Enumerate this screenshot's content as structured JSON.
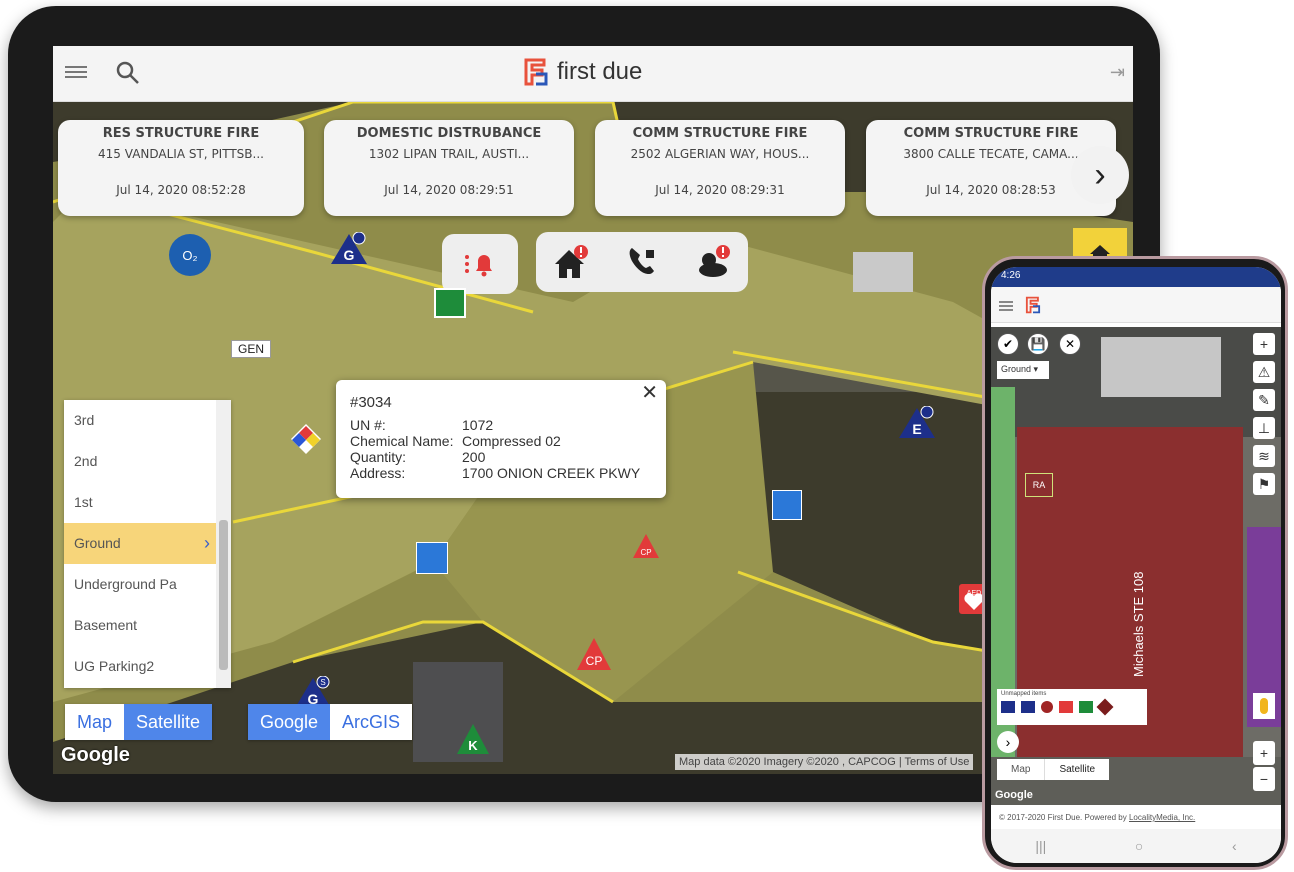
{
  "tablet": {
    "header": {
      "brand": "first due"
    },
    "incidents": [
      {
        "type": "RES STRUCTURE FIRE",
        "address": "415 VANDALIA ST, PITTSB...",
        "datetime": "Jul 14, 2020 08:52:28"
      },
      {
        "type": "DOMESTIC DISTRUBANCE",
        "address": "1302 LIPAN TRAIL, AUSTI...",
        "datetime": "Jul 14, 2020 08:29:51"
      },
      {
        "type": "COMM STRUCTURE FIRE",
        "address": "2502 ALGERIAN WAY, HOUS...",
        "datetime": "Jul 14, 2020 08:29:31"
      },
      {
        "type": "COMM STRUCTURE FIRE",
        "address": "3800 CALLE TECATE, CAMA...",
        "datetime": "Jul 14, 2020 08:28:53"
      }
    ],
    "popup": {
      "id": "#3034",
      "rows": [
        {
          "label": "UN #:",
          "value": "1072"
        },
        {
          "label": "Chemical Name:",
          "value": "Compressed 02"
        },
        {
          "label": "Quantity:",
          "value": "200"
        },
        {
          "label": "Address:",
          "value": "1700 ONION CREEK PKWY"
        }
      ]
    },
    "floors": [
      "3rd",
      "2nd",
      "1st",
      "Ground",
      "Underground Pa",
      "Basement",
      "UG Parking2"
    ],
    "selected_floor": "Ground",
    "map_type": {
      "map": "Map",
      "satellite": "Satellite"
    },
    "provider": {
      "google": "Google",
      "arcgis": "ArcGIS"
    },
    "map_labels": {
      "gen": "GEN",
      "google_logo": "Google",
      "attribution": "Map data ©2020 Imagery ©2020 , CAPCOG  |  Terms of Use"
    },
    "markers": {
      "cp": "CP",
      "k": "K",
      "g": "G",
      "e": "E",
      "s": "S",
      "aed": "AED"
    }
  },
  "phone": {
    "status_time": "4:26",
    "floor_select": "Ground",
    "building_label": "Michaels STE 108",
    "marker_ra": "RA",
    "unmapped_title": "Unmapped items",
    "map_type": {
      "map": "Map",
      "satellite": "Satellite"
    },
    "footer_text": "© 2017-2020 First Due. Powered by",
    "footer_link": "LocalityMedia, Inc.",
    "google_logo": "Google"
  },
  "colors": {
    "accent": "#4f86ea",
    "brand": "#e8523c",
    "selected_floor": "#f7d57a",
    "phone_status": "#1f3c8a"
  }
}
